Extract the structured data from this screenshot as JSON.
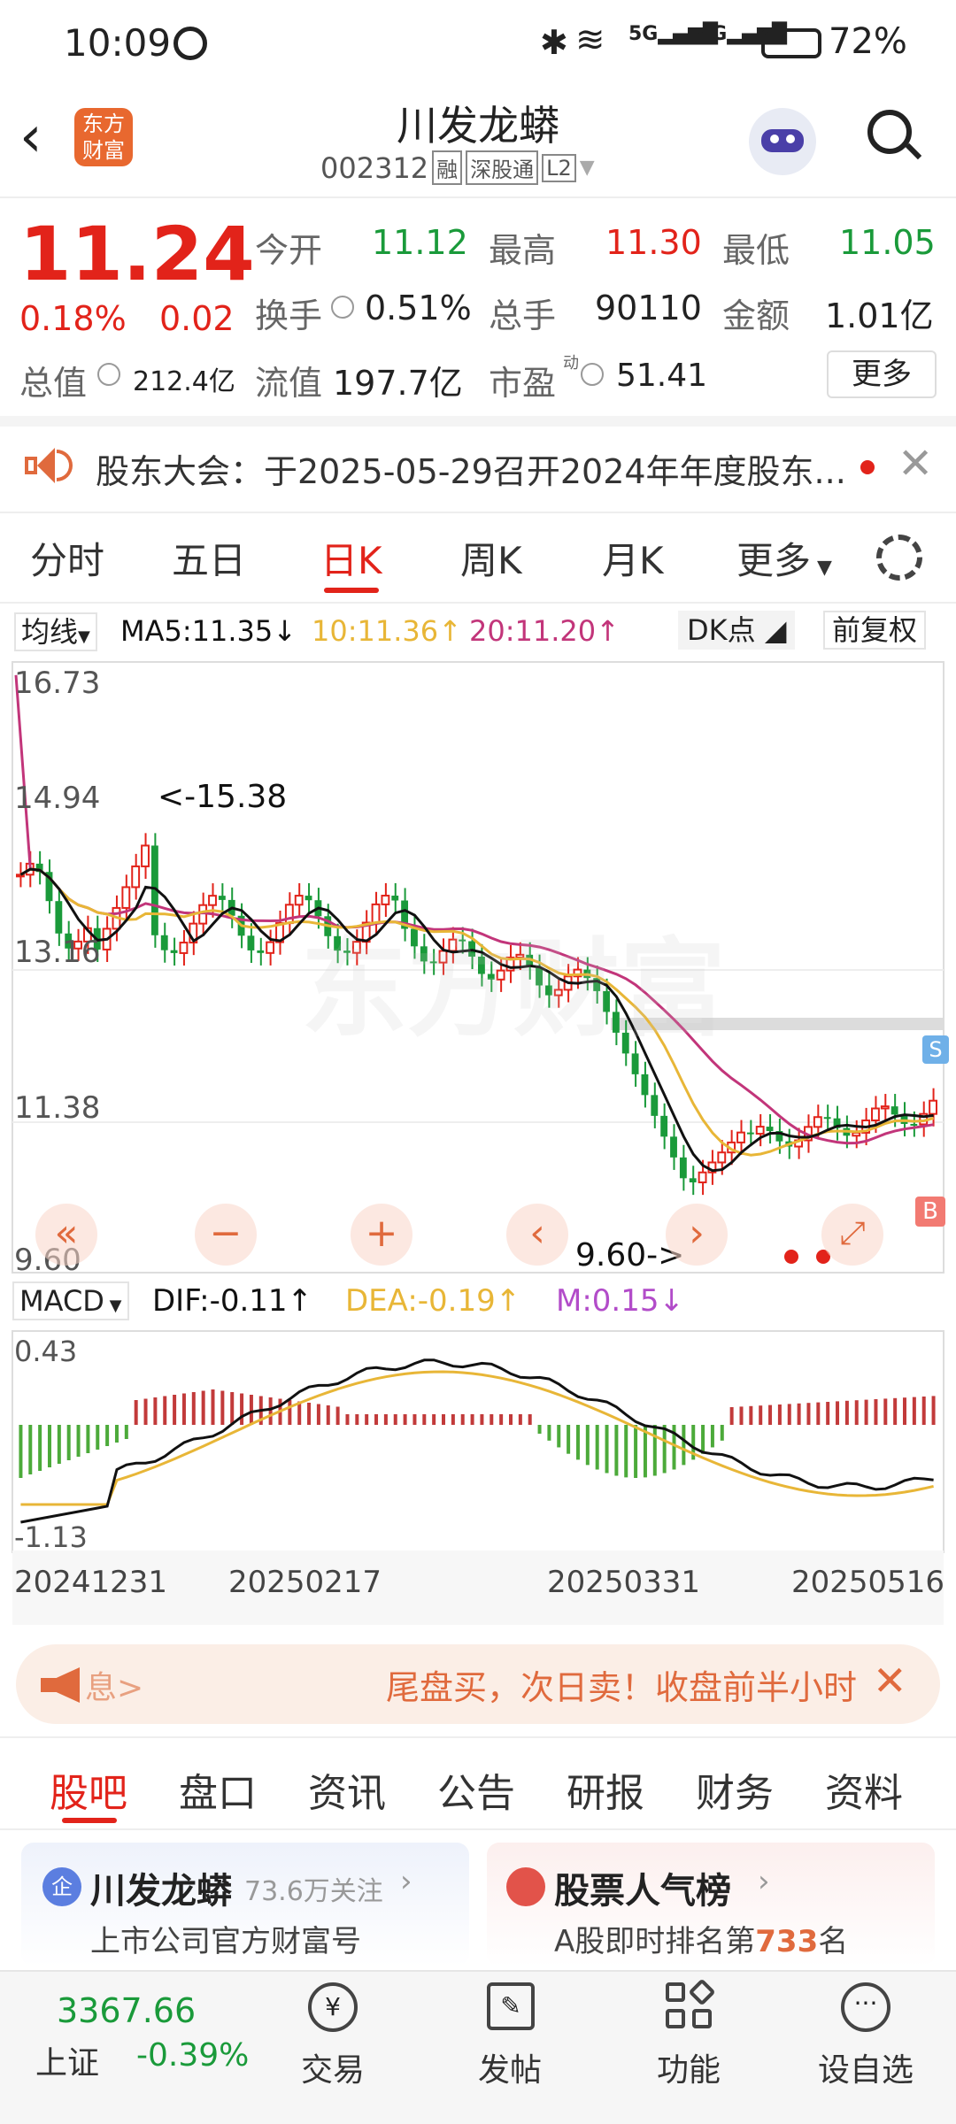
{
  "status": {
    "time": "10:09",
    "battery": "72%",
    "net1": "5G",
    "net2": "4G"
  },
  "header": {
    "title": "川发龙蟒",
    "code": "002312",
    "badges": [
      "融",
      "深股通",
      "L2"
    ],
    "logo_line1": "东方",
    "logo_line2": "财富"
  },
  "quote": {
    "price": "11.24",
    "pct": "0.18%",
    "chg": "0.02",
    "open_label": "今开",
    "open": "11.12",
    "high_label": "最高",
    "high": "11.30",
    "low_label": "最低",
    "low": "11.05",
    "turn_label": "换手",
    "turn": "0.51%",
    "vol_label": "总手",
    "vol": "90110",
    "amt_label": "金额",
    "amt": "1.01亿",
    "mcap_label": "总值",
    "mcap": "212.4亿",
    "float_label": "流值",
    "float": "197.7亿",
    "pe_label": "市盈",
    "pe_sup": "动",
    "pe": "51.41",
    "more": "更多"
  },
  "notice": {
    "text": "股东大会：于2025-05-29召开2024年年度股东..."
  },
  "tabs": [
    "分时",
    "五日",
    "日K",
    "周K",
    "月K",
    "更多"
  ],
  "ma": {
    "label": "均线",
    "ma5": "MA5:11.35↓",
    "ma10": "10:11.36↑",
    "ma20": "20:11.20↑",
    "dk": "DK点",
    "fq": "前复权"
  },
  "kchart": {
    "ticks": [
      "16.73",
      "14.94",
      "13.16",
      "11.38",
      "9.60"
    ],
    "max_note": "<-15.38",
    "min_note": "9.60->",
    "s_badge": "S",
    "b_badge": "B",
    "watermark": "东方财富"
  },
  "controls": {
    "first": "«",
    "minus": "−",
    "plus": "+",
    "prev": "‹",
    "next": "›"
  },
  "macd": {
    "label": "MACD",
    "dif": "DIF:-0.11↑",
    "dea": "DEA:-0.19↑",
    "m": "M:0.15↓",
    "top": "0.43",
    "bottom": "-1.13"
  },
  "dates": [
    "20241231",
    "20250217",
    "20250331",
    "20250516"
  ],
  "banner": {
    "left": "息>",
    "text": "尾盘买，次日卖！收盘前半小时"
  },
  "bottom_tabs": [
    "股吧",
    "盘口",
    "资讯",
    "公告",
    "研报",
    "财务",
    "资料"
  ],
  "cards": {
    "c1_title": "川发龙蟒",
    "c1_follow": "73.6万关注",
    "c1_sub": "上市公司官方财富号",
    "c2_title": "股票人气榜",
    "c2_sub_a": "A股即时排名第",
    "c2_rank": "733",
    "c2_sub_b": "名"
  },
  "nav": {
    "index_value": "3367.66",
    "index_name": "上证",
    "index_chg": "-0.39%",
    "items": [
      "交易",
      "发帖",
      "功能",
      "设自选"
    ]
  },
  "colors": {
    "up": "#e2231a",
    "down": "#1a9a3a",
    "ma5": "#111111",
    "ma10": "#e8b637",
    "ma20": "#c2357a"
  }
}
